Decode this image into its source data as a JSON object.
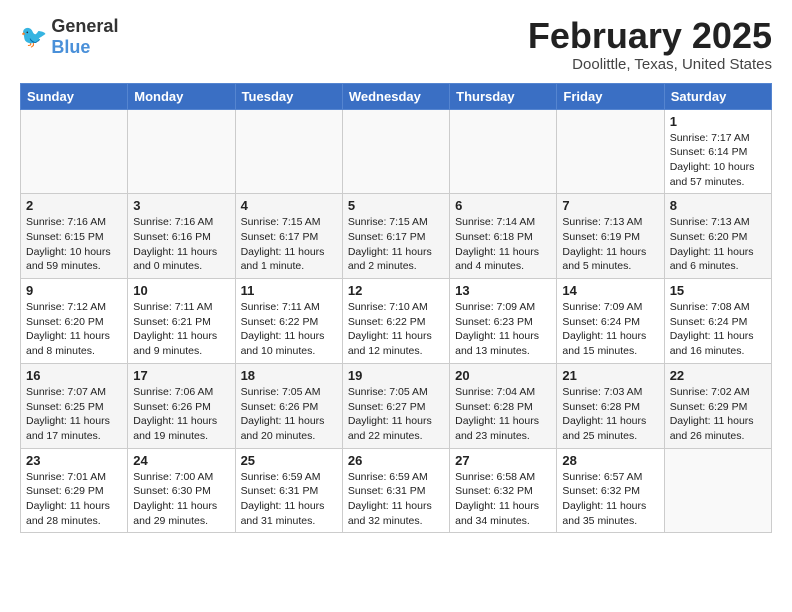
{
  "header": {
    "logo_general": "General",
    "logo_blue": "Blue",
    "month_title": "February 2025",
    "location": "Doolittle, Texas, United States"
  },
  "days_of_week": [
    "Sunday",
    "Monday",
    "Tuesday",
    "Wednesday",
    "Thursday",
    "Friday",
    "Saturday"
  ],
  "weeks": [
    [
      {
        "day": "",
        "info": ""
      },
      {
        "day": "",
        "info": ""
      },
      {
        "day": "",
        "info": ""
      },
      {
        "day": "",
        "info": ""
      },
      {
        "day": "",
        "info": ""
      },
      {
        "day": "",
        "info": ""
      },
      {
        "day": "1",
        "info": "Sunrise: 7:17 AM\nSunset: 6:14 PM\nDaylight: 10 hours and 57 minutes."
      }
    ],
    [
      {
        "day": "2",
        "info": "Sunrise: 7:16 AM\nSunset: 6:15 PM\nDaylight: 10 hours and 59 minutes."
      },
      {
        "day": "3",
        "info": "Sunrise: 7:16 AM\nSunset: 6:16 PM\nDaylight: 11 hours and 0 minutes."
      },
      {
        "day": "4",
        "info": "Sunrise: 7:15 AM\nSunset: 6:17 PM\nDaylight: 11 hours and 1 minute."
      },
      {
        "day": "5",
        "info": "Sunrise: 7:15 AM\nSunset: 6:17 PM\nDaylight: 11 hours and 2 minutes."
      },
      {
        "day": "6",
        "info": "Sunrise: 7:14 AM\nSunset: 6:18 PM\nDaylight: 11 hours and 4 minutes."
      },
      {
        "day": "7",
        "info": "Sunrise: 7:13 AM\nSunset: 6:19 PM\nDaylight: 11 hours and 5 minutes."
      },
      {
        "day": "8",
        "info": "Sunrise: 7:13 AM\nSunset: 6:20 PM\nDaylight: 11 hours and 6 minutes."
      }
    ],
    [
      {
        "day": "9",
        "info": "Sunrise: 7:12 AM\nSunset: 6:20 PM\nDaylight: 11 hours and 8 minutes."
      },
      {
        "day": "10",
        "info": "Sunrise: 7:11 AM\nSunset: 6:21 PM\nDaylight: 11 hours and 9 minutes."
      },
      {
        "day": "11",
        "info": "Sunrise: 7:11 AM\nSunset: 6:22 PM\nDaylight: 11 hours and 10 minutes."
      },
      {
        "day": "12",
        "info": "Sunrise: 7:10 AM\nSunset: 6:22 PM\nDaylight: 11 hours and 12 minutes."
      },
      {
        "day": "13",
        "info": "Sunrise: 7:09 AM\nSunset: 6:23 PM\nDaylight: 11 hours and 13 minutes."
      },
      {
        "day": "14",
        "info": "Sunrise: 7:09 AM\nSunset: 6:24 PM\nDaylight: 11 hours and 15 minutes."
      },
      {
        "day": "15",
        "info": "Sunrise: 7:08 AM\nSunset: 6:24 PM\nDaylight: 11 hours and 16 minutes."
      }
    ],
    [
      {
        "day": "16",
        "info": "Sunrise: 7:07 AM\nSunset: 6:25 PM\nDaylight: 11 hours and 17 minutes."
      },
      {
        "day": "17",
        "info": "Sunrise: 7:06 AM\nSunset: 6:26 PM\nDaylight: 11 hours and 19 minutes."
      },
      {
        "day": "18",
        "info": "Sunrise: 7:05 AM\nSunset: 6:26 PM\nDaylight: 11 hours and 20 minutes."
      },
      {
        "day": "19",
        "info": "Sunrise: 7:05 AM\nSunset: 6:27 PM\nDaylight: 11 hours and 22 minutes."
      },
      {
        "day": "20",
        "info": "Sunrise: 7:04 AM\nSunset: 6:28 PM\nDaylight: 11 hours and 23 minutes."
      },
      {
        "day": "21",
        "info": "Sunrise: 7:03 AM\nSunset: 6:28 PM\nDaylight: 11 hours and 25 minutes."
      },
      {
        "day": "22",
        "info": "Sunrise: 7:02 AM\nSunset: 6:29 PM\nDaylight: 11 hours and 26 minutes."
      }
    ],
    [
      {
        "day": "23",
        "info": "Sunrise: 7:01 AM\nSunset: 6:29 PM\nDaylight: 11 hours and 28 minutes."
      },
      {
        "day": "24",
        "info": "Sunrise: 7:00 AM\nSunset: 6:30 PM\nDaylight: 11 hours and 29 minutes."
      },
      {
        "day": "25",
        "info": "Sunrise: 6:59 AM\nSunset: 6:31 PM\nDaylight: 11 hours and 31 minutes."
      },
      {
        "day": "26",
        "info": "Sunrise: 6:59 AM\nSunset: 6:31 PM\nDaylight: 11 hours and 32 minutes."
      },
      {
        "day": "27",
        "info": "Sunrise: 6:58 AM\nSunset: 6:32 PM\nDaylight: 11 hours and 34 minutes."
      },
      {
        "day": "28",
        "info": "Sunrise: 6:57 AM\nSunset: 6:32 PM\nDaylight: 11 hours and 35 minutes."
      },
      {
        "day": "",
        "info": ""
      }
    ]
  ]
}
